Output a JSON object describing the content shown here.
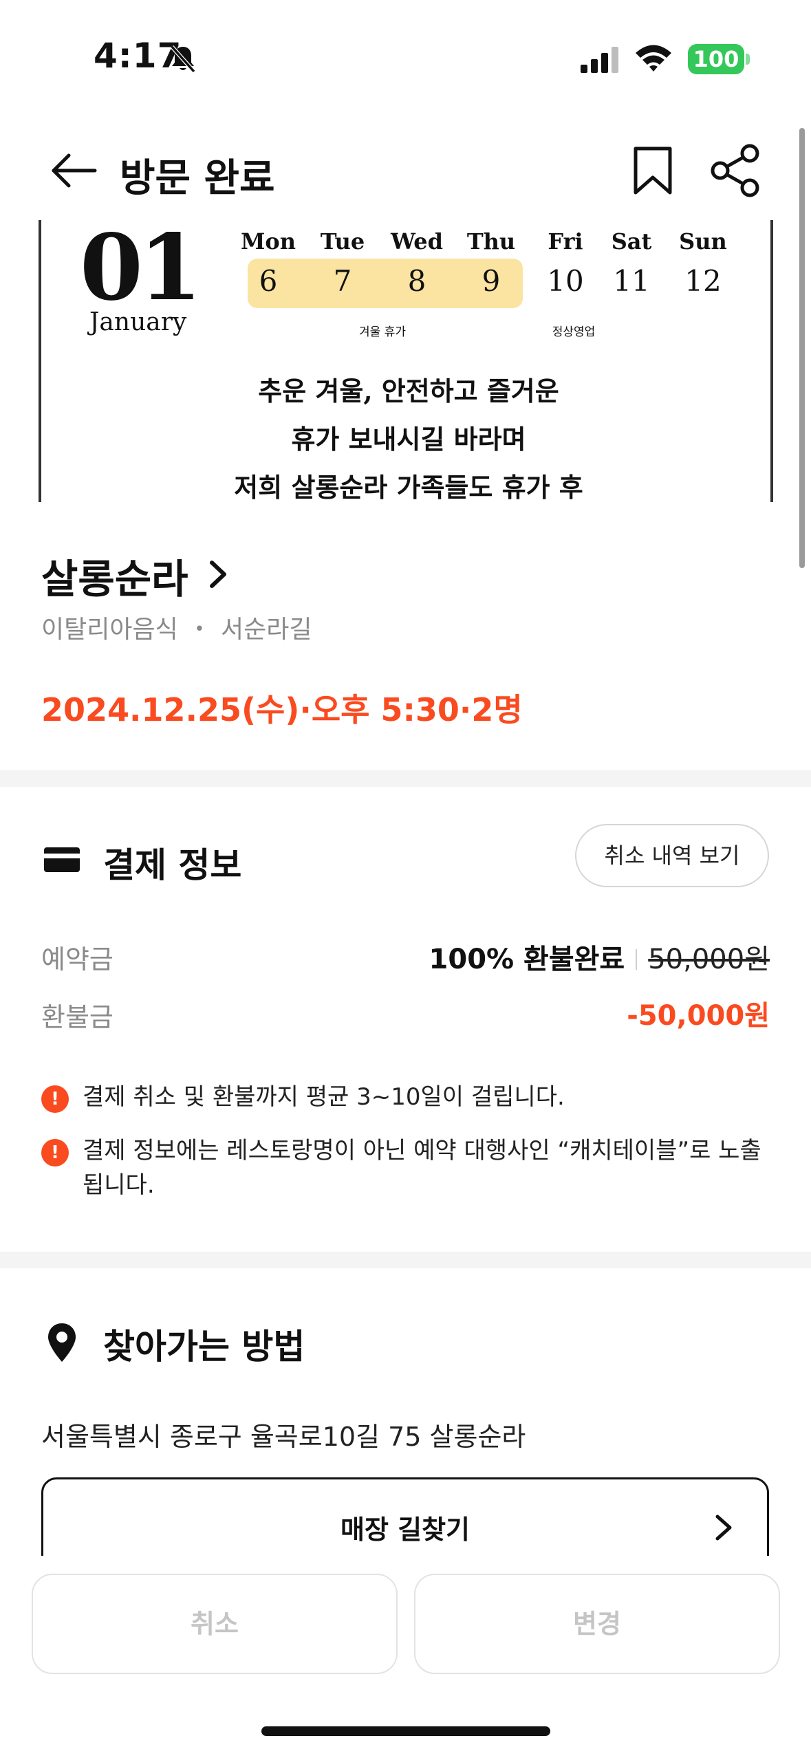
{
  "status_bar": {
    "time": "4:17",
    "battery": "100"
  },
  "header": {
    "title": "방문 완료"
  },
  "banner": {
    "day": "01",
    "month": "January",
    "weekdays": [
      "Mon",
      "Tue",
      "Wed",
      "Thu",
      "Fri",
      "Sat",
      "Sun"
    ],
    "dates": [
      "6",
      "7",
      "8",
      "9",
      "10",
      "11",
      "12"
    ],
    "note_holiday": "겨울 휴가",
    "note_open": "정상영업",
    "lines": [
      "추운 겨울, 안전하고 즐거운",
      "휴가 보내시길 바라며",
      "저희 살롱순라 가족들도 휴가 후"
    ]
  },
  "restaurant": {
    "name": "살롱순라",
    "category": "이탈리아음식",
    "location": "서순라길",
    "reservation": "2024.12.25(수)·오후 5:30·2명"
  },
  "payment": {
    "title": "결제 정보",
    "history_button": "취소 내역 보기",
    "deposit_label": "예약금",
    "deposit_status": "100% 환불완료",
    "deposit_amount": "50,000원",
    "refund_label": "환불금",
    "refund_amount": "-50,000원",
    "notices": [
      "결제 취소 및 환불까지 평균 3~10일이 걸립니다.",
      "결제 정보에는 레스토랑명이 아닌 예약 대행사인 “캐치테이블”로 노출됩니다."
    ]
  },
  "directions": {
    "title": "찾아가는 방법",
    "address": "서울특별시 종로구 율곡로10길 75 살롱순라",
    "route_button": "매장 길찾기"
  },
  "bottom": {
    "cancel": "취소",
    "change": "변경"
  },
  "colors": {
    "accent": "#fa4a1f",
    "battery": "#34c759",
    "highlight": "#fbe3a2"
  }
}
